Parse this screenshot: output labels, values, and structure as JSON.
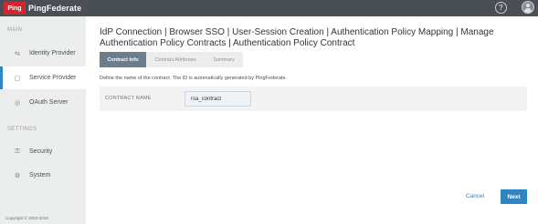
{
  "header": {
    "logo_mark": "Ping",
    "product_name": "PingFederate",
    "help_icon": "question-circle-icon",
    "user_icon": "user-avatar-icon"
  },
  "sidebar": {
    "main_heading": "MAIN",
    "main_items": [
      {
        "label": "Identity Provider",
        "icon": "identity-provider-icon"
      },
      {
        "label": "Service Provider",
        "icon": "service-provider-icon",
        "active": true
      },
      {
        "label": "OAuth Server",
        "icon": "oauth-server-icon"
      }
    ],
    "settings_heading": "SETTINGS",
    "settings_items": [
      {
        "label": "Security",
        "icon": "lock-icon"
      },
      {
        "label": "System",
        "icon": "system-icon"
      }
    ],
    "copyright": "Copyright © 2003-2019"
  },
  "main": {
    "breadcrumb": "IdP Connection | Browser SSO | User-Session Creation | Authentication Policy Mapping | Manage Authentication Policy Contracts | Authentication Policy Contract",
    "tabs": [
      {
        "label": "Contract Info",
        "active": true
      },
      {
        "label": "Contract Attributes",
        "active": false
      },
      {
        "label": "Summary",
        "active": false
      }
    ],
    "description": "Define the name of the contract. The ID is automatically generated by PingFederate.",
    "contract_name_label": "CONTRACT NAME",
    "contract_name_value": "rsa_contract",
    "cancel_label": "Cancel",
    "next_label": "Next"
  },
  "colors": {
    "topbar": "#4a4e55",
    "accent": "#2f84c4",
    "brand_red": "#d22630",
    "active_tab": "#6b7d8f"
  }
}
